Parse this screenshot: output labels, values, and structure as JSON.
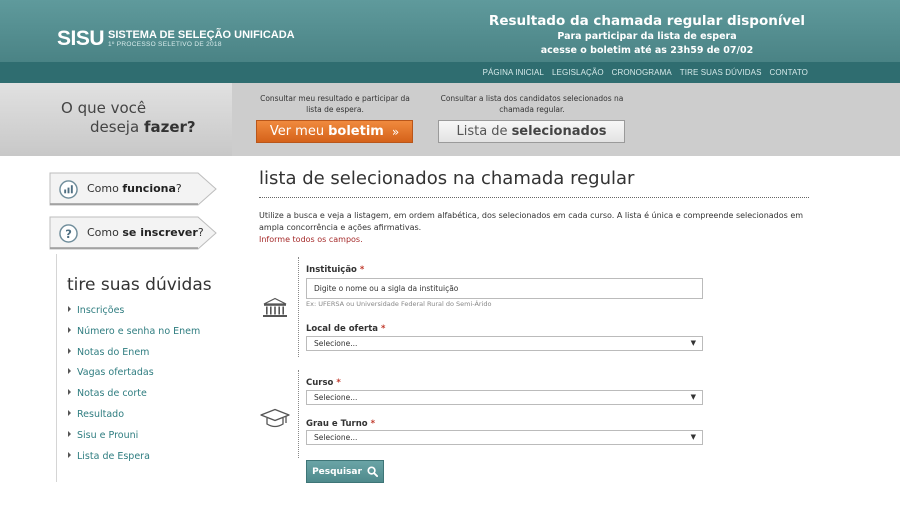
{
  "header": {
    "logo_mark": "SISU",
    "logo_title": "SISTEMA DE SELEÇÃO UNIFICADA",
    "logo_subtitle": "1º PROCESSO SELETIVO DE 2018",
    "notice_title": "Resultado da chamada regular disponível",
    "notice_line1": "Para participar da lista de espera",
    "notice_line2": "acesse o boletim até as 23h59 de 07/02"
  },
  "nav": {
    "items": [
      "PÁGINA INICIAL",
      "LEGISLAÇÃO",
      "CRONOGRAMA",
      "TIRE SUAS DÚVIDAS",
      "CONTATO"
    ]
  },
  "action": {
    "question_line1": "O que você",
    "question_line2_prefix": "deseja",
    "question_line2_bold": "fazer?",
    "desc_boletim": "Consultar meu resultado e participar da lista de espera.",
    "desc_lista": "Consultar a lista dos candidatos selecionados na chamada regular.",
    "btn_boletim_prefix": "Ver meu",
    "btn_boletim_bold": "boletim",
    "btn_boletim_arrow": "»",
    "btn_lista_prefix": "Lista de",
    "btn_lista_bold": "selecionados"
  },
  "sidebar": {
    "tab1_prefix": "Como",
    "tab1_bold": "funciona",
    "tab1_suffix": "?",
    "tab2_prefix": "Como",
    "tab2_bold": "se inscrever",
    "tab2_suffix": "?",
    "faq_title": "tire suas dúvidas",
    "faq_items": [
      "Inscrições",
      "Número e senha no Enem",
      "Notas do Enem",
      "Vagas ofertadas",
      "Notas de corte",
      "Resultado",
      "Sisu e Prouni",
      "Lista de Espera"
    ]
  },
  "main": {
    "title": "lista de selecionados na chamada regular",
    "intro": "Utilize a busca e veja a listagem, em ordem alfabética, dos selecionados em cada curso. A lista é única e compreende selecionados em ampla concorrência e ações afirmativas.",
    "warning": "Informe todos os campos.",
    "form": {
      "institution_label": "Instituição",
      "required_mark": "*",
      "institution_placeholder": "Digite o nome ou a sigla da instituição",
      "institution_hint": "Ex: UFERSA ou Universidade Federal Rural do Semi-Árido",
      "local_label": "Local de oferta",
      "curso_label": "Curso",
      "grau_label": "Grau e Turno",
      "select_default": "Selecione...",
      "search_label": "Pesquisar"
    }
  },
  "colors": {
    "header": "#5a9496",
    "nav": "#2f6d70",
    "orange_button": "#e36f25",
    "link": "#2f7d80",
    "required": "#c0392b"
  },
  "icons": [
    "chart-icon",
    "question-icon",
    "institution-icon",
    "graduation-cap-icon",
    "search-icon",
    "chevron-down-icon"
  ]
}
